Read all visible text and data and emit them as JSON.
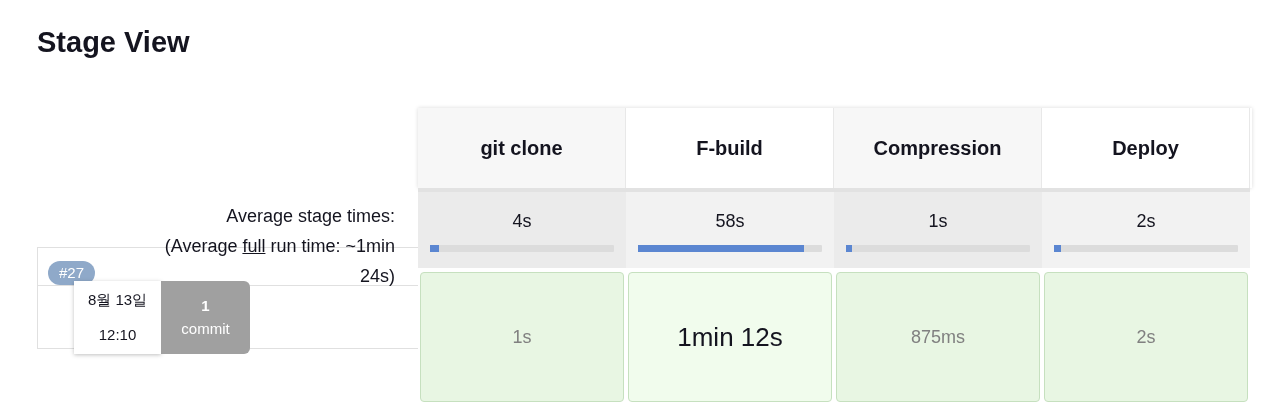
{
  "title": "Stage View",
  "averages": {
    "label": "Average stage times:",
    "full_prefix": "(Average ",
    "full_link": "full",
    "full_suffix": " run time: ~1min 24s)"
  },
  "stages": [
    {
      "name": "git clone",
      "average": "4s",
      "level": 0.05
    },
    {
      "name": "F-build",
      "average": "58s",
      "level": 0.9
    },
    {
      "name": "Compression",
      "average": "1s",
      "level": 0.03
    },
    {
      "name": "Deploy",
      "average": "2s",
      "level": 0.04
    }
  ],
  "builds": [
    {
      "number": "#27",
      "date": "8월 13일",
      "time": "12:10",
      "commits_count": "1",
      "commits_label": "commit",
      "cells": [
        {
          "duration": "1s",
          "highlighted": false
        },
        {
          "duration": "1min 12s",
          "highlighted": true
        },
        {
          "duration": "875ms",
          "highlighted": false
        },
        {
          "duration": "2s",
          "highlighted": false
        }
      ]
    }
  ]
}
